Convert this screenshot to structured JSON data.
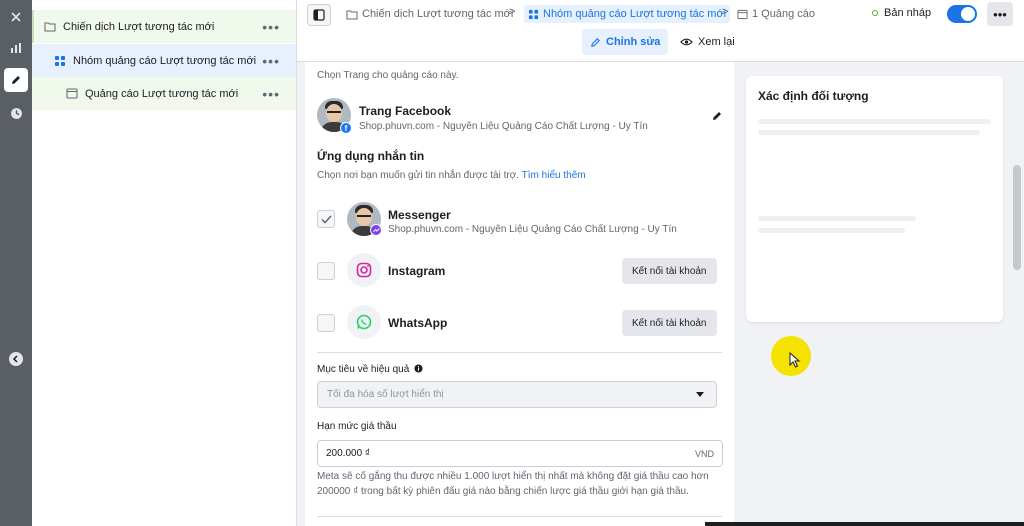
{
  "rail": {
    "items": [
      "close",
      "chart",
      "edit",
      "history"
    ]
  },
  "tree": {
    "campaign": {
      "label": "Chiến dịch Lượt tương tác mới",
      "more": "•••"
    },
    "adset": {
      "label": "Nhóm quảng cáo Lượt tương tác mới",
      "more": "•••"
    },
    "ad": {
      "label": "Quảng cáo Lượt tương tác mới",
      "more": "•••"
    }
  },
  "breadcrumb": {
    "campaign": "Chiến dịch Lượt tương tác mới",
    "adset": "Nhóm quảng cáo Lượt tương tác mới",
    "ads": "1 Quảng cáo",
    "sep": ">"
  },
  "status": {
    "label": "Bản nháp"
  },
  "more_button": "•••",
  "tabs": {
    "edit": "Chỉnh sửa",
    "view": "Xem lại"
  },
  "page_section": {
    "intro": "Chọn Trang cho quảng cáo này.",
    "page_name": "Trang Facebook",
    "page_sub": "Shop.phuvn.com - Nguyên Liệu Quảng Cáo Chất Lượng - Uy Tín"
  },
  "messaging": {
    "heading": "Ứng dụng nhắn tin",
    "desc": "Chọn nơi bạn muốn gửi tin nhắn được tài trợ.",
    "learn_more": "Tìm hiểu thêm",
    "apps": [
      {
        "name": "Messenger",
        "sub": "Shop.phuvn.com - Nguyên Liệu Quảng Cáo Chất Lượng - Uy Tín",
        "checked": true
      },
      {
        "name": "Instagram",
        "button": "Kết nối tài khoản",
        "checked": false
      },
      {
        "name": "WhatsApp",
        "button": "Kết nối tài khoản",
        "checked": false
      }
    ]
  },
  "performance": {
    "label": "Mục tiêu về hiệu quả",
    "selected": "Tối đa hóa số lượt hiển thị"
  },
  "bid": {
    "label": "Hạn mức giá thầu",
    "value": "200.000 ₫",
    "unit": "VND",
    "helper": "Meta sẽ cố gắng thu được nhiều 1.000 lượt hiển thị nhất mà không đặt giá thầu cao hơn 200000 ₫ trong bất kỳ phiên đấu giá nào bằng chiến lược giá thầu giới hạn giá thầu."
  },
  "audience": {
    "title": "Xác định đối tượng"
  },
  "colors": {
    "accent": "#1b74e4",
    "status_green": "#42b72a",
    "highlight": "#f4e200"
  }
}
